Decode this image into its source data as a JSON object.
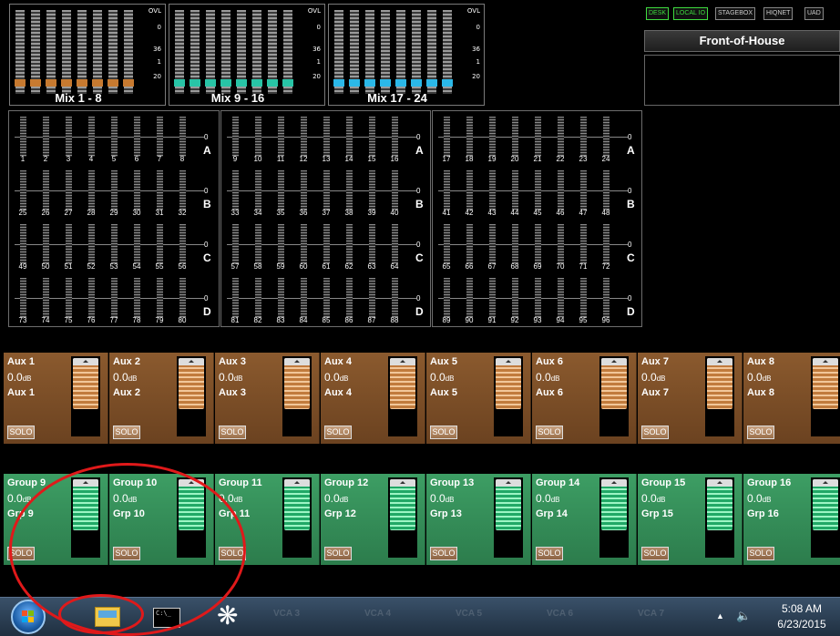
{
  "mix_overview": [
    {
      "label": "Mix 1 - 8",
      "cap_color": "#c77a30",
      "scale": [
        "OVL",
        "0",
        "36",
        "1",
        "20"
      ]
    },
    {
      "label": "Mix 9 - 16",
      "cap_color": "#28c4a6",
      "scale": [
        "OVL",
        "0",
        "36",
        "1",
        "20"
      ]
    },
    {
      "label": "Mix 17 - 24",
      "cap_color": "#2bb8e8",
      "scale": [
        "OVL",
        "0",
        "36",
        "1",
        "20"
      ]
    }
  ],
  "status_badges": [
    {
      "label": "DESK",
      "active": true
    },
    {
      "label": "LOCAL IO",
      "active": true
    },
    {
      "label": "STAGEBOX",
      "active": false
    },
    {
      "label": "HIQNET",
      "active": false
    },
    {
      "label": "UAD",
      "active": false
    }
  ],
  "location_title": "Front-of-House",
  "channel_grid": {
    "row_letters": [
      "A",
      "B",
      "C",
      "D"
    ],
    "zero_label": "0",
    "blocks": [
      {
        "rows": [
          [
            "1",
            "2",
            "3",
            "4",
            "5",
            "6",
            "7",
            "8"
          ],
          [
            "25",
            "26",
            "27",
            "28",
            "29",
            "30",
            "31",
            "32"
          ],
          [
            "49",
            "50",
            "51",
            "52",
            "53",
            "54",
            "55",
            "56"
          ],
          [
            "73",
            "74",
            "75",
            "76",
            "77",
            "78",
            "79",
            "80"
          ]
        ]
      },
      {
        "rows": [
          [
            "9",
            "10",
            "11",
            "12",
            "13",
            "14",
            "15",
            "16"
          ],
          [
            "33",
            "34",
            "35",
            "36",
            "37",
            "38",
            "39",
            "40"
          ],
          [
            "57",
            "58",
            "59",
            "60",
            "61",
            "62",
            "63",
            "64"
          ],
          [
            "81",
            "82",
            "83",
            "84",
            "85",
            "86",
            "87",
            "88"
          ]
        ]
      },
      {
        "rows": [
          [
            "17",
            "18",
            "19",
            "20",
            "21",
            "22",
            "23",
            "24"
          ],
          [
            "41",
            "42",
            "43",
            "44",
            "45",
            "46",
            "47",
            "48"
          ],
          [
            "65",
            "66",
            "67",
            "68",
            "69",
            "70",
            "71",
            "72"
          ],
          [
            "89",
            "90",
            "91",
            "92",
            "93",
            "94",
            "95",
            "96"
          ]
        ]
      }
    ]
  },
  "aux_strips": [
    {
      "name": "Aux 1",
      "gain": "0.0",
      "unit": "dB",
      "label": "Aux 1",
      "solo": "SOLO"
    },
    {
      "name": "Aux 2",
      "gain": "0.0",
      "unit": "dB",
      "label": "Aux 2",
      "solo": "SOLO"
    },
    {
      "name": "Aux 3",
      "gain": "0.0",
      "unit": "dB",
      "label": "Aux 3",
      "solo": "SOLO"
    },
    {
      "name": "Aux 4",
      "gain": "0.0",
      "unit": "dB",
      "label": "Aux 4",
      "solo": "SOLO"
    },
    {
      "name": "Aux 5",
      "gain": "0.0",
      "unit": "dB",
      "label": "Aux 5",
      "solo": "SOLO"
    },
    {
      "name": "Aux 6",
      "gain": "0.0",
      "unit": "dB",
      "label": "Aux 6",
      "solo": "SOLO"
    },
    {
      "name": "Aux 7",
      "gain": "0.0",
      "unit": "dB",
      "label": "Aux 7",
      "solo": "SOLO"
    },
    {
      "name": "Aux 8",
      "gain": "0.0",
      "unit": "dB",
      "label": "Aux 8",
      "solo": "SOLO"
    }
  ],
  "group_strips": [
    {
      "name": "Group 9",
      "gain": "0.0",
      "unit": "dB",
      "label": "Grp 9",
      "solo": "SOLO"
    },
    {
      "name": "Group 10",
      "gain": "0.0",
      "unit": "dB",
      "label": "Grp 10",
      "solo": "SOLO"
    },
    {
      "name": "Group 11",
      "gain": "0.0",
      "unit": "dB",
      "label": "Grp 11",
      "solo": "SOLO"
    },
    {
      "name": "Group 12",
      "gain": "0.0",
      "unit": "dB",
      "label": "Grp 12",
      "solo": "SOLO"
    },
    {
      "name": "Group 13",
      "gain": "0.0",
      "unit": "dB",
      "label": "Grp 13",
      "solo": "SOLO"
    },
    {
      "name": "Group 14",
      "gain": "0.0",
      "unit": "dB",
      "label": "Grp 14",
      "solo": "SOLO"
    },
    {
      "name": "Group 15",
      "gain": "0.0",
      "unit": "dB",
      "label": "Grp 15",
      "solo": "SOLO"
    },
    {
      "name": "Group 16",
      "gain": "0.0",
      "unit": "dB",
      "label": "Grp 16",
      "solo": "SOLO"
    }
  ],
  "taskbar": {
    "cmd_icon_text": "C:\\_",
    "ghost_labels": [
      "VCA 3",
      "VCA 4",
      "VCA 5",
      "VCA 6",
      "VCA 7"
    ],
    "time": "5:08 AM",
    "date": "6/23/2015"
  }
}
